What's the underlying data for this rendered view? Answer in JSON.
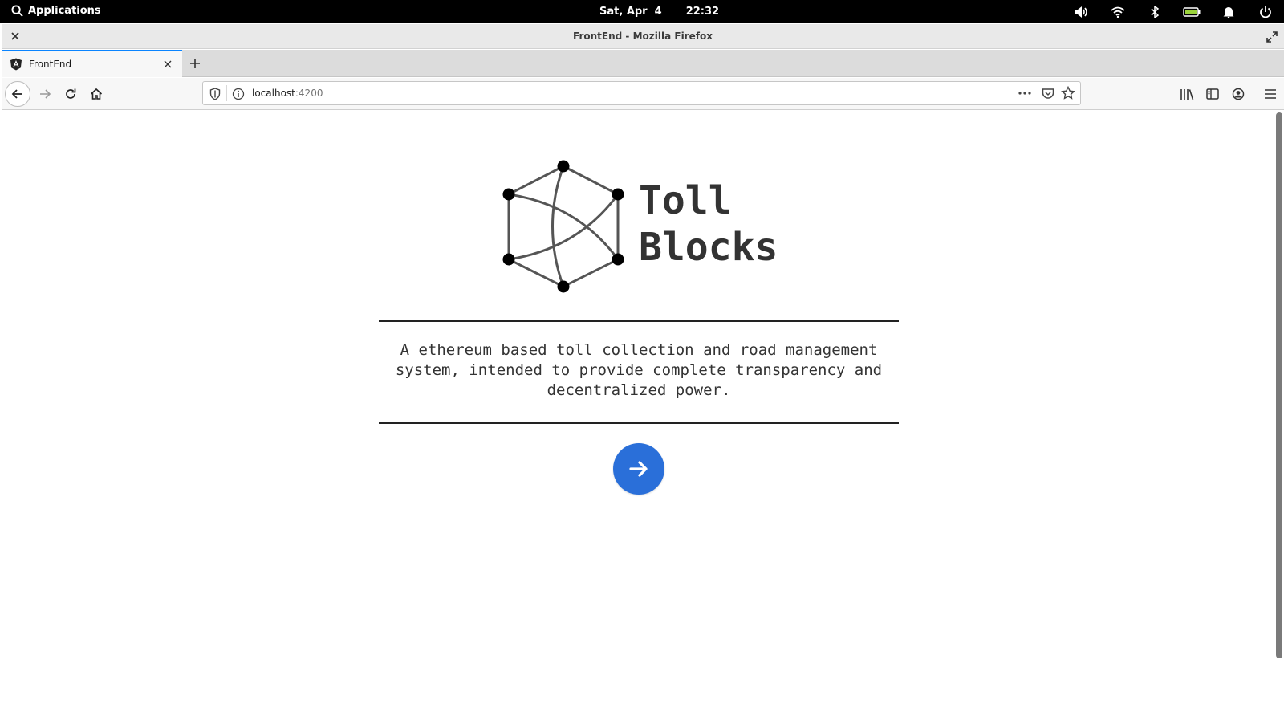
{
  "system_bar": {
    "apps_label": "Applications",
    "date": "Sat, Apr  4",
    "time": "22:32",
    "icons": [
      "volume-icon",
      "wifi-icon",
      "bluetooth-icon",
      "battery-icon",
      "notification-bell-icon",
      "power-icon"
    ]
  },
  "window": {
    "title": "FrontEnd - Mozilla Firefox"
  },
  "tabs": [
    {
      "label": "FrontEnd",
      "active": true,
      "icon": "angular-icon"
    }
  ],
  "navbar": {
    "url_host": "localhost",
    "url_port": ":4200"
  },
  "page": {
    "brand_line1": "Toll",
    "brand_line2": "Blocks",
    "description": "A ethereum based toll collection and road management system, intended to provide complete transparency and decentralized power.",
    "go_button_icon": "arrow-right-icon",
    "accent_color": "#2a6fd9"
  }
}
